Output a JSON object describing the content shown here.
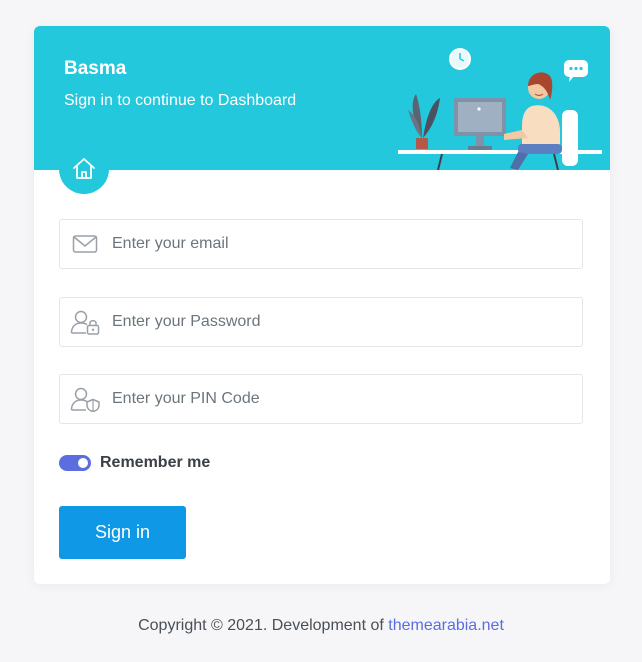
{
  "header": {
    "brand": "Basma",
    "subtitle": "Sign in to continue to Dashboard"
  },
  "form": {
    "email_placeholder": "Enter your email",
    "password_placeholder": "Enter your Password",
    "pin_placeholder": "Enter your PIN Code",
    "remember_label": "Remember me",
    "remember_checked": true,
    "signin_label": "Sign in"
  },
  "footer": {
    "copyright": "Copyright © 2021. Development of",
    "link_text": "themearabia.net"
  },
  "colors": {
    "banner": "#23c8dc",
    "primary_button": "#0f98e6",
    "toggle": "#5a6ee0",
    "link": "#5a6ee0"
  },
  "icons": {
    "logo": "home-icon",
    "email": "envelope-icon",
    "password": "user-lock-icon",
    "pin": "user-shield-icon"
  }
}
